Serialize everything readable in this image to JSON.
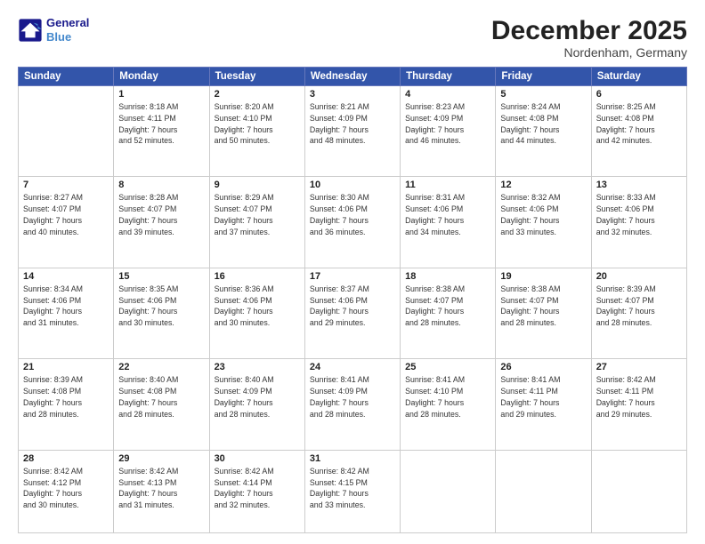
{
  "header": {
    "logo_line1": "General",
    "logo_line2": "Blue",
    "month": "December 2025",
    "location": "Nordenham, Germany"
  },
  "weekdays": [
    "Sunday",
    "Monday",
    "Tuesday",
    "Wednesday",
    "Thursday",
    "Friday",
    "Saturday"
  ],
  "weeks": [
    [
      {
        "day": "",
        "info": ""
      },
      {
        "day": "1",
        "info": "Sunrise: 8:18 AM\nSunset: 4:11 PM\nDaylight: 7 hours\nand 52 minutes."
      },
      {
        "day": "2",
        "info": "Sunrise: 8:20 AM\nSunset: 4:10 PM\nDaylight: 7 hours\nand 50 minutes."
      },
      {
        "day": "3",
        "info": "Sunrise: 8:21 AM\nSunset: 4:09 PM\nDaylight: 7 hours\nand 48 minutes."
      },
      {
        "day": "4",
        "info": "Sunrise: 8:23 AM\nSunset: 4:09 PM\nDaylight: 7 hours\nand 46 minutes."
      },
      {
        "day": "5",
        "info": "Sunrise: 8:24 AM\nSunset: 4:08 PM\nDaylight: 7 hours\nand 44 minutes."
      },
      {
        "day": "6",
        "info": "Sunrise: 8:25 AM\nSunset: 4:08 PM\nDaylight: 7 hours\nand 42 minutes."
      }
    ],
    [
      {
        "day": "7",
        "info": "Sunrise: 8:27 AM\nSunset: 4:07 PM\nDaylight: 7 hours\nand 40 minutes."
      },
      {
        "day": "8",
        "info": "Sunrise: 8:28 AM\nSunset: 4:07 PM\nDaylight: 7 hours\nand 39 minutes."
      },
      {
        "day": "9",
        "info": "Sunrise: 8:29 AM\nSunset: 4:07 PM\nDaylight: 7 hours\nand 37 minutes."
      },
      {
        "day": "10",
        "info": "Sunrise: 8:30 AM\nSunset: 4:06 PM\nDaylight: 7 hours\nand 36 minutes."
      },
      {
        "day": "11",
        "info": "Sunrise: 8:31 AM\nSunset: 4:06 PM\nDaylight: 7 hours\nand 34 minutes."
      },
      {
        "day": "12",
        "info": "Sunrise: 8:32 AM\nSunset: 4:06 PM\nDaylight: 7 hours\nand 33 minutes."
      },
      {
        "day": "13",
        "info": "Sunrise: 8:33 AM\nSunset: 4:06 PM\nDaylight: 7 hours\nand 32 minutes."
      }
    ],
    [
      {
        "day": "14",
        "info": "Sunrise: 8:34 AM\nSunset: 4:06 PM\nDaylight: 7 hours\nand 31 minutes."
      },
      {
        "day": "15",
        "info": "Sunrise: 8:35 AM\nSunset: 4:06 PM\nDaylight: 7 hours\nand 30 minutes."
      },
      {
        "day": "16",
        "info": "Sunrise: 8:36 AM\nSunset: 4:06 PM\nDaylight: 7 hours\nand 30 minutes."
      },
      {
        "day": "17",
        "info": "Sunrise: 8:37 AM\nSunset: 4:06 PM\nDaylight: 7 hours\nand 29 minutes."
      },
      {
        "day": "18",
        "info": "Sunrise: 8:38 AM\nSunset: 4:07 PM\nDaylight: 7 hours\nand 28 minutes."
      },
      {
        "day": "19",
        "info": "Sunrise: 8:38 AM\nSunset: 4:07 PM\nDaylight: 7 hours\nand 28 minutes."
      },
      {
        "day": "20",
        "info": "Sunrise: 8:39 AM\nSunset: 4:07 PM\nDaylight: 7 hours\nand 28 minutes."
      }
    ],
    [
      {
        "day": "21",
        "info": "Sunrise: 8:39 AM\nSunset: 4:08 PM\nDaylight: 7 hours\nand 28 minutes."
      },
      {
        "day": "22",
        "info": "Sunrise: 8:40 AM\nSunset: 4:08 PM\nDaylight: 7 hours\nand 28 minutes."
      },
      {
        "day": "23",
        "info": "Sunrise: 8:40 AM\nSunset: 4:09 PM\nDaylight: 7 hours\nand 28 minutes."
      },
      {
        "day": "24",
        "info": "Sunrise: 8:41 AM\nSunset: 4:09 PM\nDaylight: 7 hours\nand 28 minutes."
      },
      {
        "day": "25",
        "info": "Sunrise: 8:41 AM\nSunset: 4:10 PM\nDaylight: 7 hours\nand 28 minutes."
      },
      {
        "day": "26",
        "info": "Sunrise: 8:41 AM\nSunset: 4:11 PM\nDaylight: 7 hours\nand 29 minutes."
      },
      {
        "day": "27",
        "info": "Sunrise: 8:42 AM\nSunset: 4:11 PM\nDaylight: 7 hours\nand 29 minutes."
      }
    ],
    [
      {
        "day": "28",
        "info": "Sunrise: 8:42 AM\nSunset: 4:12 PM\nDaylight: 7 hours\nand 30 minutes."
      },
      {
        "day": "29",
        "info": "Sunrise: 8:42 AM\nSunset: 4:13 PM\nDaylight: 7 hours\nand 31 minutes."
      },
      {
        "day": "30",
        "info": "Sunrise: 8:42 AM\nSunset: 4:14 PM\nDaylight: 7 hours\nand 32 minutes."
      },
      {
        "day": "31",
        "info": "Sunrise: 8:42 AM\nSunset: 4:15 PM\nDaylight: 7 hours\nand 33 minutes."
      },
      {
        "day": "",
        "info": ""
      },
      {
        "day": "",
        "info": ""
      },
      {
        "day": "",
        "info": ""
      }
    ]
  ]
}
